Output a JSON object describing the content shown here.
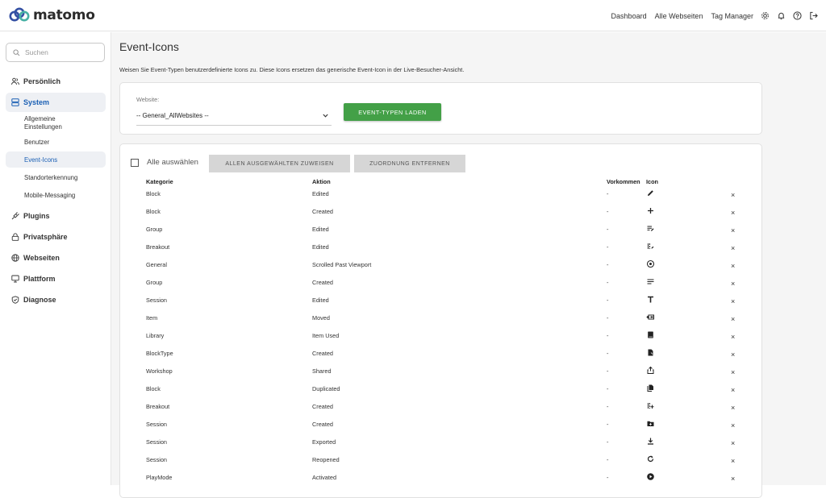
{
  "app": {
    "logo_text": "matomo",
    "brand_color": "#3450a3"
  },
  "topnav": {
    "dashboard": "Dashboard",
    "all_websites": "Alle Webseiten",
    "tag_manager": "Tag Manager",
    "icons": [
      "gear-icon",
      "bell-icon",
      "help-icon",
      "logout-icon"
    ]
  },
  "sidebar": {
    "search_placeholder": "Suchen",
    "personal": "Persönlich",
    "system": "System",
    "system_items": [
      "Allgemeine Einstellungen",
      "Benutzer",
      "Event-Icons",
      "Standorterkennung",
      "Mobile-Messaging"
    ],
    "plugins": "Plugins",
    "privacy": "Privatsphäre",
    "websites": "Webseiten",
    "platform": "Plattform",
    "diagnostics": "Diagnose"
  },
  "main": {
    "title": "Event-Icons",
    "description": "Weisen Sie Event-Typen benutzerdefinierte Icons zu. Diese Icons ersetzen das generische Event-Icon in der Live-Besucher-Ansicht.",
    "website_label": "Website:",
    "website_value": "-- General_AllWebsites --",
    "load_button": "EVENT-TYPEN LADEN",
    "select_all": "Alle auswählen",
    "assign_button": "ALLEN AUSGEWÄHLTEN ZUWEISEN",
    "remove_button": "ZUORDNUNG ENTFERNEN",
    "accent_green": "#43a047",
    "columns": {
      "category": "Kategorie",
      "action": "Aktion",
      "occurrences": "Vorkommen",
      "icon": "Icon"
    },
    "rows": [
      {
        "category": "Block",
        "action": "Edited",
        "occurrences": "-",
        "icon": "pencil-icon",
        "remove": "×"
      },
      {
        "category": "Block",
        "action": "Created",
        "occurrences": "-",
        "icon": "plus-icon",
        "remove": "×"
      },
      {
        "category": "Group",
        "action": "Edited",
        "occurrences": "-",
        "icon": "list-edit-icon",
        "remove": "×"
      },
      {
        "category": "Breakout",
        "action": "Edited",
        "occurrences": "-",
        "icon": "split-edit-icon",
        "remove": "×"
      },
      {
        "category": "General",
        "action": "Scrolled Past Viewport",
        "occurrences": "-",
        "icon": "target-circle-icon",
        "remove": "×"
      },
      {
        "category": "Group",
        "action": "Created",
        "occurrences": "-",
        "icon": "lines-icon",
        "remove": "×"
      },
      {
        "category": "Session",
        "action": "Edited",
        "occurrences": "-",
        "icon": "text-t-icon",
        "remove": "×"
      },
      {
        "category": "Item",
        "action": "Moved",
        "occurrences": "-",
        "icon": "move-card-icon",
        "remove": "×"
      },
      {
        "category": "Library",
        "action": "Item Used",
        "occurrences": "-",
        "icon": "book-icon",
        "remove": "×"
      },
      {
        "category": "BlockType",
        "action": "Created",
        "occurrences": "-",
        "icon": "new-doc-icon",
        "remove": "×"
      },
      {
        "category": "Workshop",
        "action": "Shared",
        "occurrences": "-",
        "icon": "share-icon",
        "remove": "×"
      },
      {
        "category": "Block",
        "action": "Duplicated",
        "occurrences": "-",
        "icon": "copy-icon",
        "remove": "×"
      },
      {
        "category": "Breakout",
        "action": "Created",
        "occurrences": "-",
        "icon": "split-add-icon",
        "remove": "×"
      },
      {
        "category": "Session",
        "action": "Created",
        "occurrences": "-",
        "icon": "folder-add-icon",
        "remove": "×"
      },
      {
        "category": "Session",
        "action": "Exported",
        "occurrences": "-",
        "icon": "download-icon",
        "remove": "×"
      },
      {
        "category": "Session",
        "action": "Reopened",
        "occurrences": "-",
        "icon": "refresh-icon",
        "remove": "×"
      },
      {
        "category": "PlayMode",
        "action": "Activated",
        "occurrences": "-",
        "icon": "play-circle-icon",
        "remove": "×"
      }
    ]
  }
}
